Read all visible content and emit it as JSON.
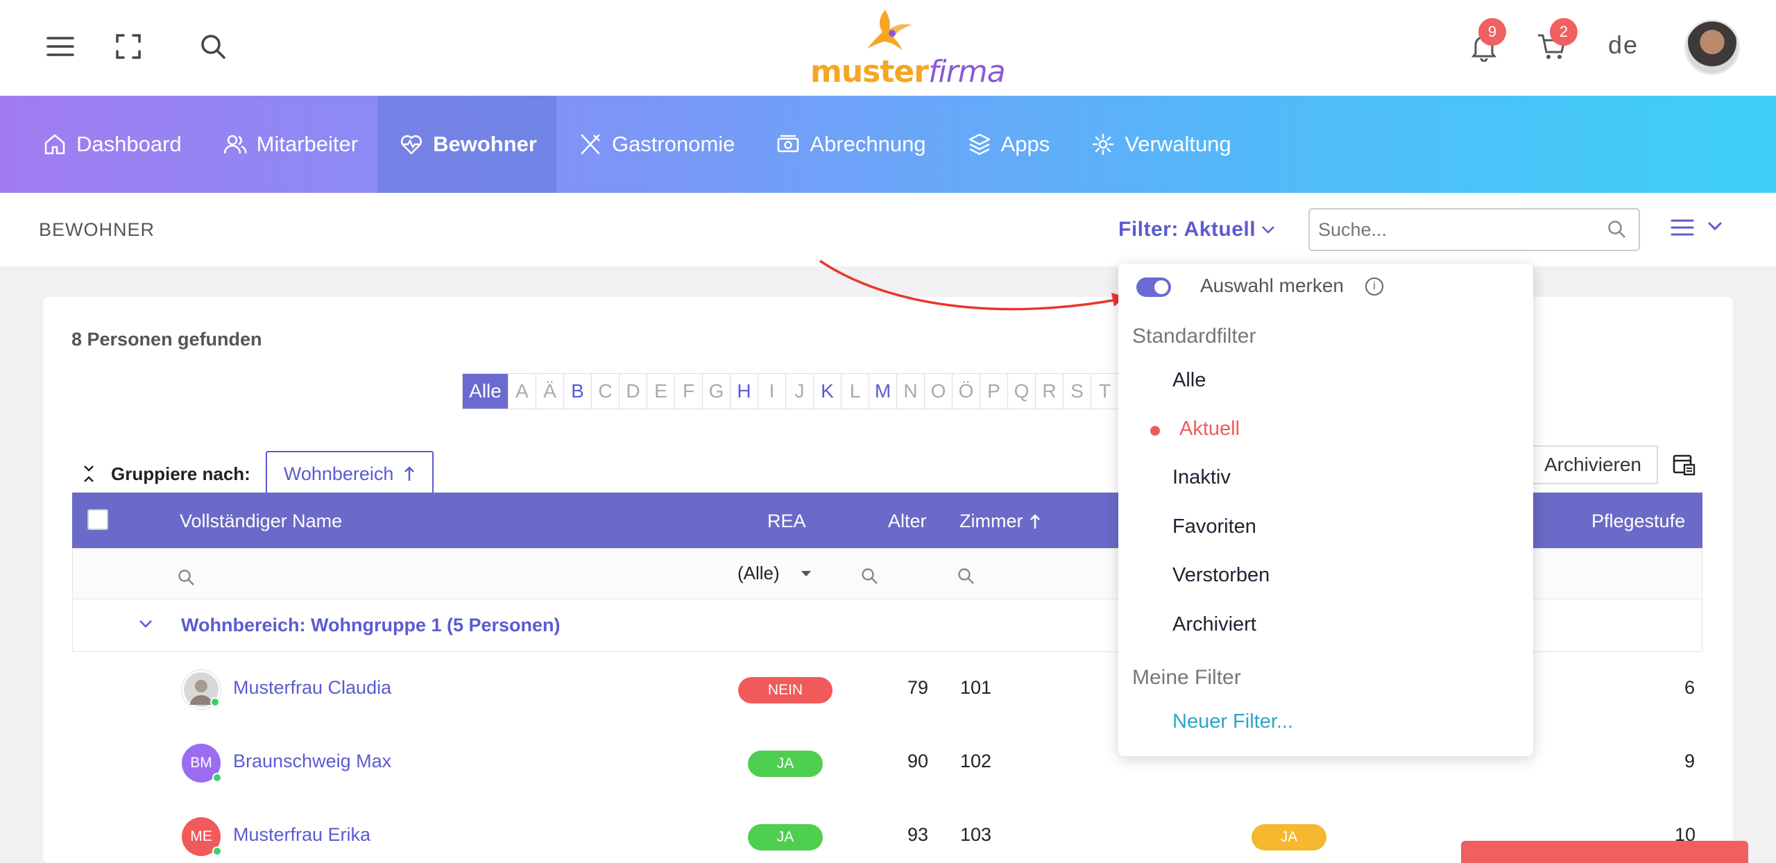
{
  "topbar": {
    "brand_part1": "muster",
    "brand_part2": "firma",
    "notifications_count": "9",
    "cart_count": "2",
    "language": "de"
  },
  "nav": {
    "items": [
      {
        "label": "Dashboard",
        "icon": "home-icon"
      },
      {
        "label": "Mitarbeiter",
        "icon": "users-icon"
      },
      {
        "label": "Bewohner",
        "icon": "heart-pulse-icon",
        "active": true
      },
      {
        "label": "Gastronomie",
        "icon": "cutlery-icon"
      },
      {
        "label": "Abrechnung",
        "icon": "money-icon"
      },
      {
        "label": "Apps",
        "icon": "layers-icon"
      },
      {
        "label": "Verwaltung",
        "icon": "gear-icon"
      }
    ]
  },
  "subheader": {
    "title": "BEWOHNER",
    "filter_label": "Filter: Aktuell",
    "search_placeholder": "Suche..."
  },
  "main": {
    "found_text": "8 Personen gefunden",
    "alphabet": [
      "Alle",
      "A",
      "Ä",
      "B",
      "C",
      "D",
      "E",
      "F",
      "G",
      "H",
      "I",
      "J",
      "K",
      "L",
      "M",
      "N",
      "O",
      "Ö",
      "P",
      "Q",
      "R",
      "S",
      "T"
    ],
    "alphabet_active": "Alle",
    "alphabet_has_entries": [
      "B",
      "H",
      "K",
      "M"
    ],
    "group_by_label": "Gruppiere nach:",
    "group_by_value": "Wohnbereich",
    "archive_button": "Archivieren"
  },
  "table": {
    "columns": {
      "name": "Vollständiger Name",
      "rea": "REA",
      "age": "Alter",
      "room": "Zimmer",
      "care_level": "Pflegestufe"
    },
    "rea_filter": "(Alle)",
    "group_header": "Wohnbereich: Wohngruppe 1 (5 Personen)",
    "rows": [
      {
        "initials": "",
        "name": "Musterfrau Claudia",
        "rea": "NEIN",
        "age": "79",
        "room": "101",
        "extra": "",
        "care": "6",
        "avatar_color": "#c9c9c9"
      },
      {
        "initials": "BM",
        "name": "Braunschweig Max",
        "rea": "JA",
        "age": "90",
        "room": "102",
        "extra": "",
        "care": "9",
        "avatar_color": "#9b6cf0"
      },
      {
        "initials": "ME",
        "name": "Musterfrau Erika",
        "rea": "JA",
        "age": "93",
        "room": "103",
        "extra": "JA",
        "care": "10",
        "avatar_color": "#f05a5a"
      }
    ]
  },
  "dropdown": {
    "remember_label": "Auswahl merken",
    "standard_header": "Standardfilter",
    "standard_items": [
      "Alle",
      "Aktuell",
      "Inaktiv",
      "Favoriten",
      "Verstorben",
      "Archiviert"
    ],
    "selected": "Aktuell",
    "my_filters_header": "Meine Filter",
    "new_filter": "Neuer Filter..."
  },
  "colors": {
    "accent": "#5b5bd0",
    "table_header": "#6a6ac8",
    "danger": "#f05a5a",
    "success": "#4fcf4f",
    "warning": "#f5b82e"
  }
}
